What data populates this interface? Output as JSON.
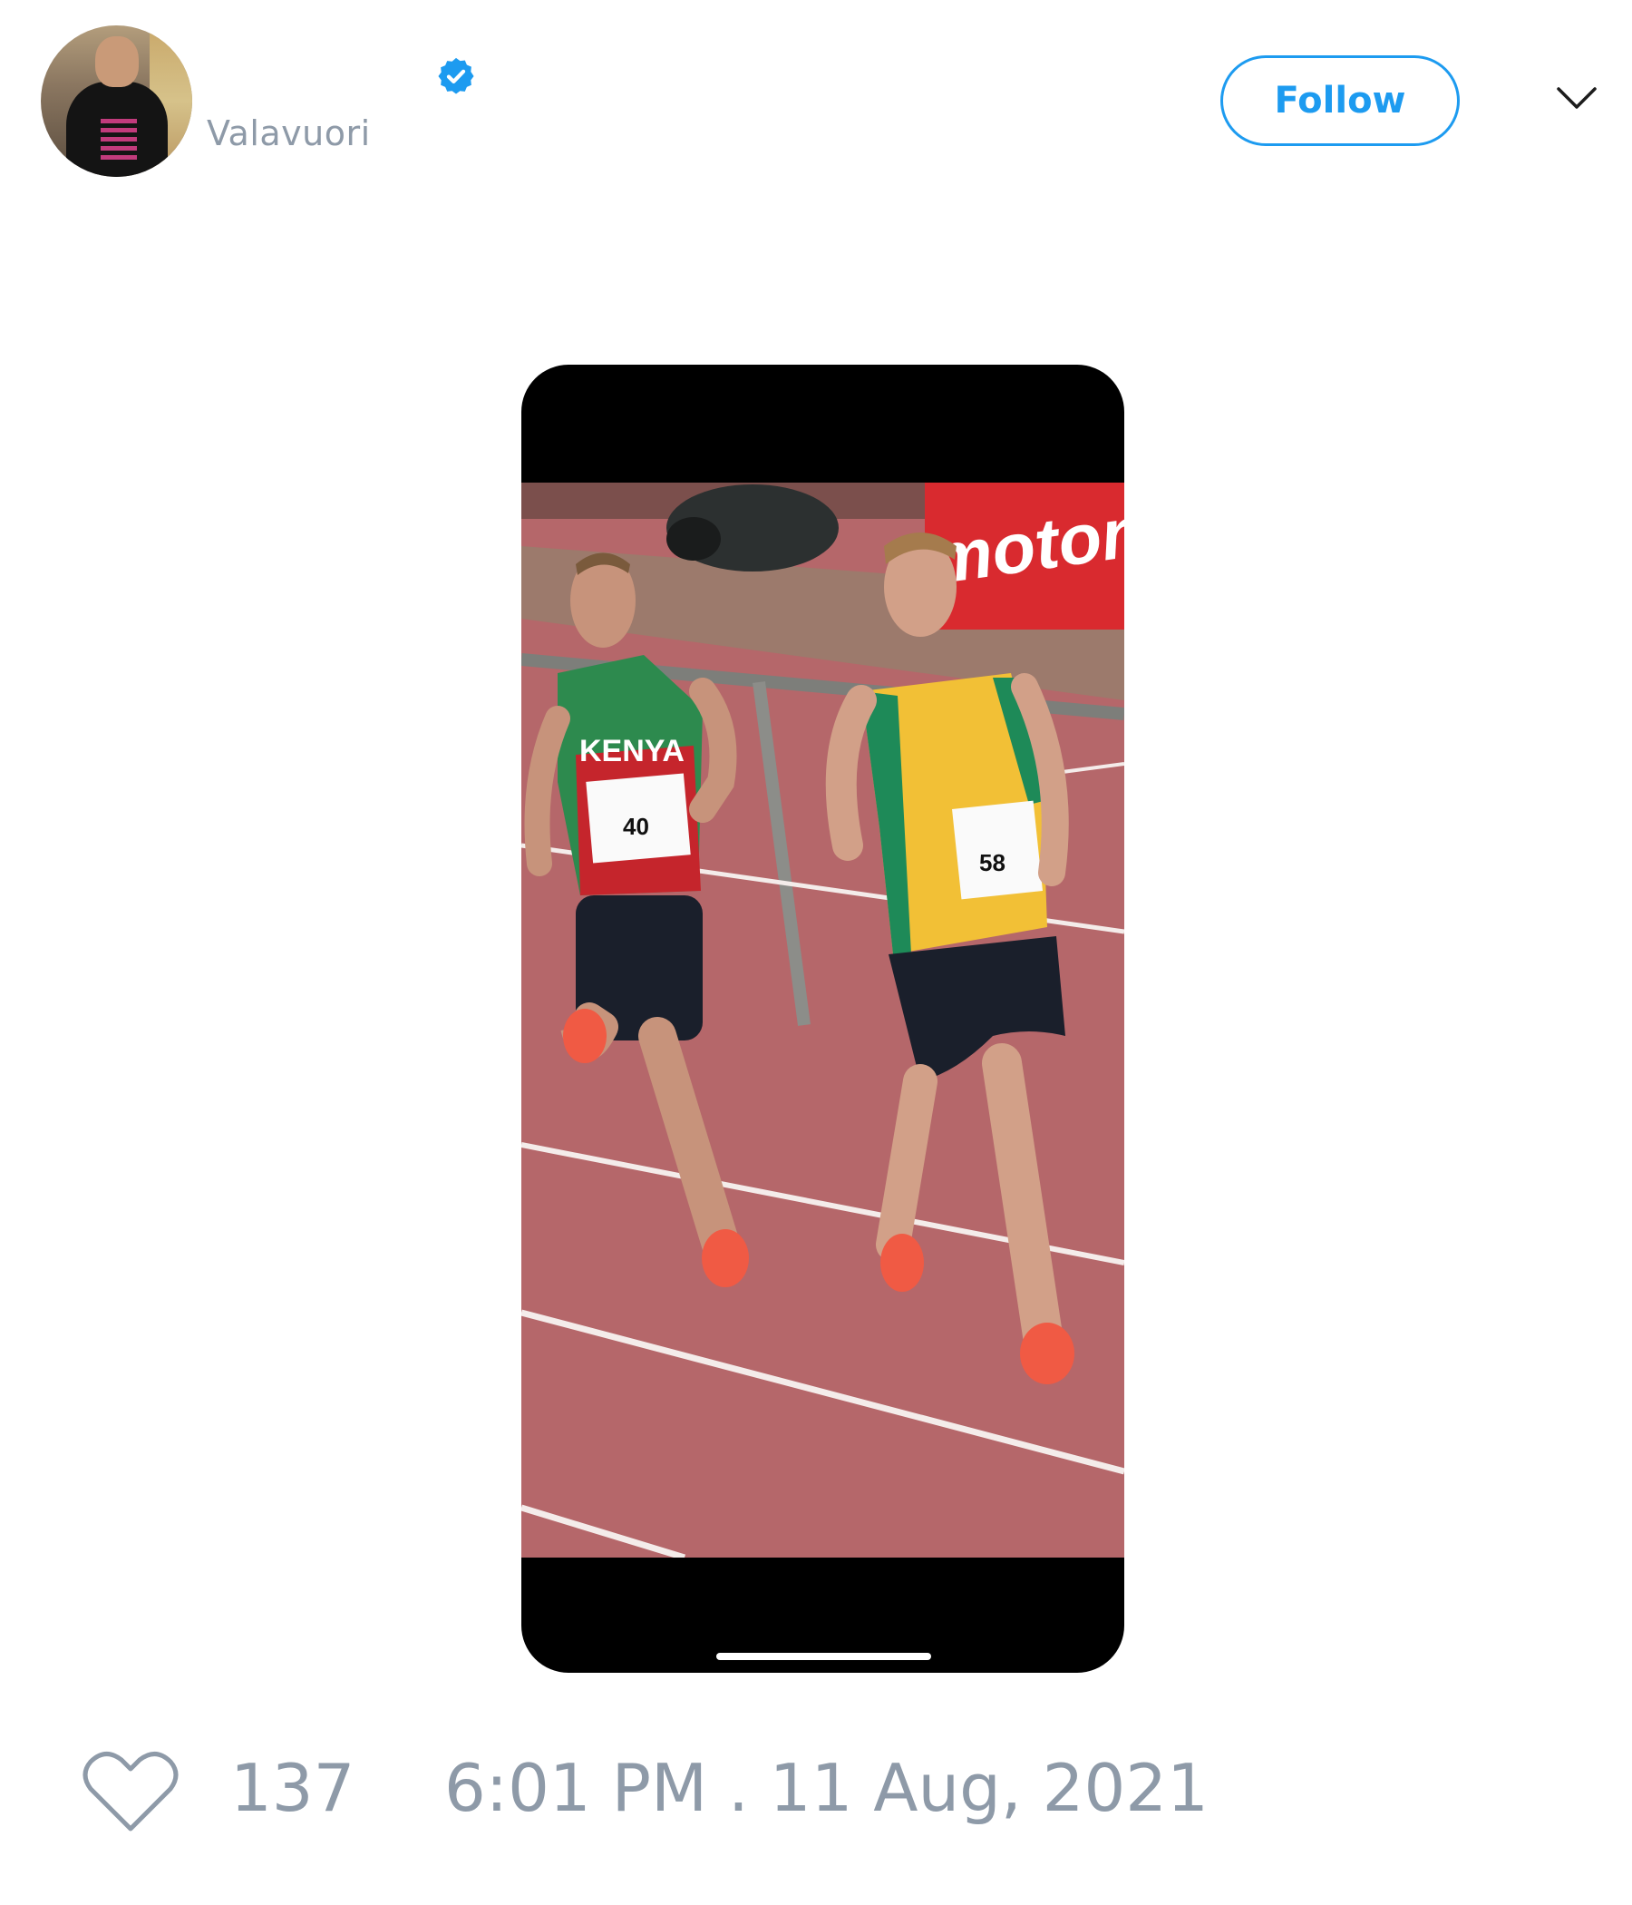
{
  "tweet": {
    "author": {
      "handle": "Valavuori",
      "verified": true
    },
    "follow_label": "Follow",
    "likes": "137",
    "timestamp": "6:01 PM . 11 Aug, 2021",
    "media": {
      "sign_text": "motonet",
      "bib_left": "40",
      "bib_right": "58",
      "jersey_left": "KENYA"
    }
  },
  "colors": {
    "accent": "#1d9bf0",
    "muted_text": "#8e9aa8",
    "track": "#b5676a"
  }
}
